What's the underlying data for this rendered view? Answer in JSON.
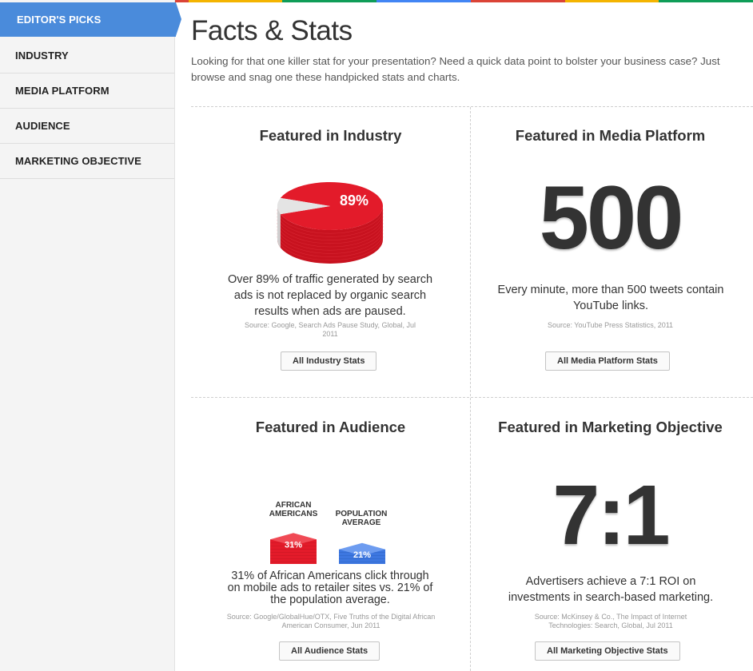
{
  "brand_stripe": [
    "#4285f4",
    "#db4437",
    "#f4b400",
    "#0f9d58",
    "#4285f4",
    "#db4437",
    "#f4b400",
    "#0f9d58"
  ],
  "sidebar": {
    "active": "EDITOR'S PICKS",
    "items": [
      {
        "label": "INDUSTRY"
      },
      {
        "label": "MEDIA PLATFORM"
      },
      {
        "label": "AUDIENCE"
      },
      {
        "label": "MARKETING OBJECTIVE"
      }
    ]
  },
  "page": {
    "title": "Facts & Stats",
    "intro": "Looking for that one killer stat for your presentation? Need a quick data point to bolster your business case? Just browse and snag one these handpicked stats and charts."
  },
  "industry": {
    "title": "Featured in Industry",
    "pct_label": "89%",
    "description": "Over 89% of traffic generated by search ads is not replaced by organic search results when ads are paused.",
    "source": "Source: Google, Search Ads Pause Study, Global, Jul 2011",
    "button": "All Industry Stats"
  },
  "media": {
    "title": "Featured in Media Platform",
    "number": "500",
    "description": "Every minute, more than 500 tweets contain YouTube links.",
    "source": "Source: YouTube Press Statistics, 2011",
    "button": "All Media Platform Stats"
  },
  "audience": {
    "title": "Featured in Audience",
    "description": "31% of African Americans click through on mobile ads to retailer sites vs. 21% of the population average.",
    "source": "Source: Google/GlobalHue/OTX, Five Truths of the Digital African American Consumer, Jun 2011",
    "button": "All Audience Stats"
  },
  "objective": {
    "title": "Featured in Marketing Objective",
    "number": "7:1",
    "description": "Advertisers achieve a 7:1 ROI on investments in search-based marketing.",
    "source": "Source: McKinsey & Co., The Impact of Internet Technologies: Search, Global, Jul 2011",
    "button": "All Marketing Objective Stats"
  },
  "chart_data": [
    {
      "type": "pie",
      "categories": [
        "",
        ""
      ],
      "values": [
        89,
        11
      ],
      "data_labels": [
        "89%",
        ""
      ],
      "colors": [
        "#e31b2a",
        "#e4e4e4"
      ]
    },
    {
      "type": "bar",
      "categories": [
        "AFRICAN AMERICANS",
        "POPULATION AVERAGE"
      ],
      "values": [
        31,
        21
      ],
      "data_labels": [
        "31%",
        "21%"
      ],
      "colors": [
        "#e31b2a",
        "#3d77e0"
      ]
    }
  ]
}
